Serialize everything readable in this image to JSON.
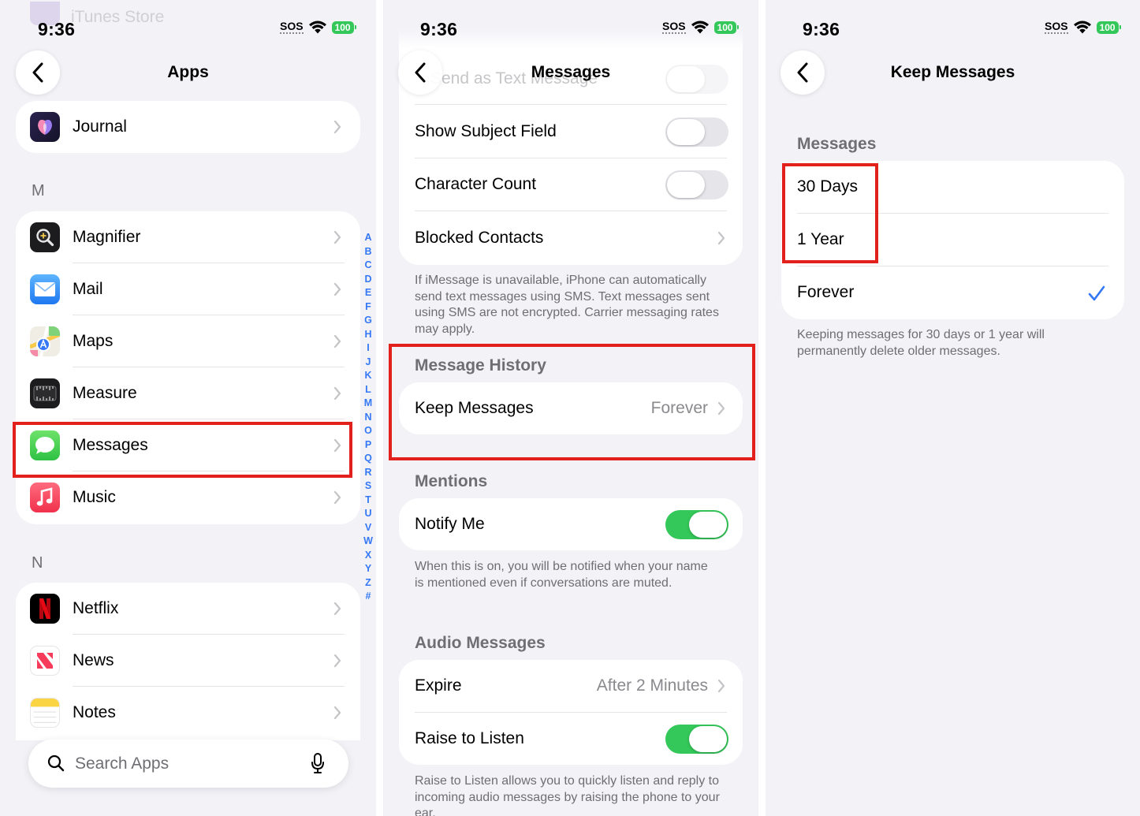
{
  "status": {
    "time": "9:36",
    "sos": "SOS",
    "battery": "100"
  },
  "panel1": {
    "faded_top": "iTunes Store",
    "title": "Apps",
    "top_items": [
      {
        "label": "Journal",
        "icon": "journal-icon"
      }
    ],
    "section_m": {
      "letter": "M",
      "items": [
        {
          "label": "Magnifier",
          "icon": "magnifier-icon"
        },
        {
          "label": "Mail",
          "icon": "mail-icon"
        },
        {
          "label": "Maps",
          "icon": "maps-icon"
        },
        {
          "label": "Measure",
          "icon": "measure-icon"
        },
        {
          "label": "Messages",
          "icon": "messages-icon"
        },
        {
          "label": "Music",
          "icon": "music-icon"
        }
      ]
    },
    "section_n": {
      "letter": "N",
      "items": [
        {
          "label": "Netflix",
          "icon": "netflix-icon"
        },
        {
          "label": "News",
          "icon": "news-icon"
        },
        {
          "label": "Notes",
          "icon": "notes-icon"
        }
      ]
    },
    "index": [
      "A",
      "B",
      "C",
      "D",
      "E",
      "F",
      "G",
      "H",
      "I",
      "J",
      "K",
      "L",
      "M",
      "N",
      "O",
      "P",
      "Q",
      "R",
      "S",
      "T",
      "U",
      "V",
      "W",
      "X",
      "Y",
      "Z",
      "#"
    ],
    "search_placeholder": "Search Apps"
  },
  "panel2": {
    "title": "Messages",
    "faded_top_text": "Send as Text Message",
    "rows1": [
      {
        "label": "Show Subject Field",
        "toggle": false
      },
      {
        "label": "Character Count",
        "toggle": false
      },
      {
        "label": "Blocked Contacts"
      }
    ],
    "sms_footer": "If iMessage is unavailable, iPhone can automatically send text messages using SMS. Text messages sent using SMS are not encrypted. Carrier messaging rates may apply.",
    "history_header": "Message History",
    "keep_messages": {
      "label": "Keep Messages",
      "value": "Forever"
    },
    "mentions_header": "Mentions",
    "notify_me": {
      "label": "Notify Me",
      "toggle": true
    },
    "mentions_footer": "When this is on, you will be notified when your name is mentioned even if conversations are muted.",
    "audio_header": "Audio Messages",
    "expire": {
      "label": "Expire",
      "value": "After 2 Minutes"
    },
    "raise_to_listen": {
      "label": "Raise to Listen",
      "toggle": true
    },
    "audio_footer": "Raise to Listen allows you to quickly listen and reply to incoming audio messages by raising the phone to your ear."
  },
  "panel3": {
    "title": "Keep Messages",
    "section_header": "Messages",
    "options": [
      {
        "label": "30 Days",
        "selected": false
      },
      {
        "label": "1 Year",
        "selected": false
      },
      {
        "label": "Forever",
        "selected": true
      }
    ],
    "footer": "Keeping messages for 30 days or 1 year will permanently delete older messages."
  },
  "colors": {
    "accent": "#3478f6",
    "toggle_on": "#34c759",
    "highlight": "#e2211c"
  }
}
